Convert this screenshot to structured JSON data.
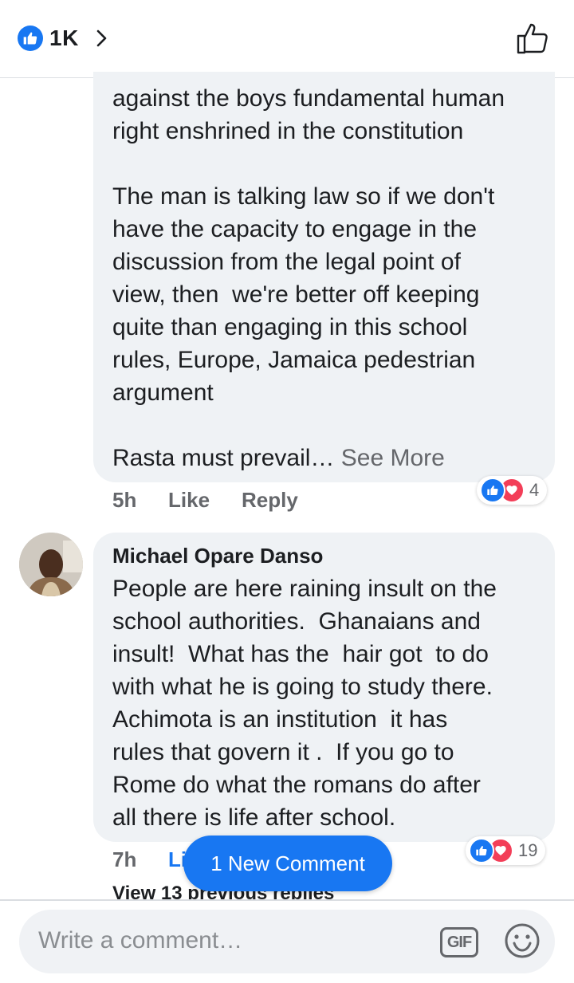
{
  "header": {
    "reaction_count": "1K"
  },
  "comments": [
    {
      "author": "",
      "text": "against the boys fundamental human\nright enshrined in the constitution\n\nThe man is talking law so if we don't\nhave the capacity to engage in the\ndiscussion from the legal point of\nview, then  we're better off keeping\nquite than engaging in this school\nrules, Europe, Jamaica pedestrian\nargument\n\nRasta must prevail…",
      "see_more": " See More",
      "time": "5h",
      "like_label": "Like",
      "reply_label": "Reply",
      "reaction_count": "4"
    },
    {
      "author": "Michael Opare Danso",
      "text": "People are here raining insult on the\nschool authorities.  Ghanaians and\ninsult!  What has the  hair got  to do\nwith what he is going to study there.\nAchimota is an institution  it has\nrules that govern it .  If you go to\nRome do what the romans do after\nall there is life after school.",
      "time": "7h",
      "like_label": "Li",
      "reaction_count": "19",
      "view_previous": "View 13 previous replies"
    }
  ],
  "new_comment_label": "1 New Comment",
  "composer": {
    "placeholder": "Write a comment…",
    "gif_label": "GIF"
  },
  "colors": {
    "accent": "#1877f2",
    "love": "#f33e58",
    "bubble": "#eff2f5",
    "meta": "#65676b"
  },
  "icons": [
    "like-icon",
    "chevron-right-icon",
    "thumbs-up-outline-icon",
    "love-icon",
    "gif-icon",
    "emoji-icon"
  ]
}
